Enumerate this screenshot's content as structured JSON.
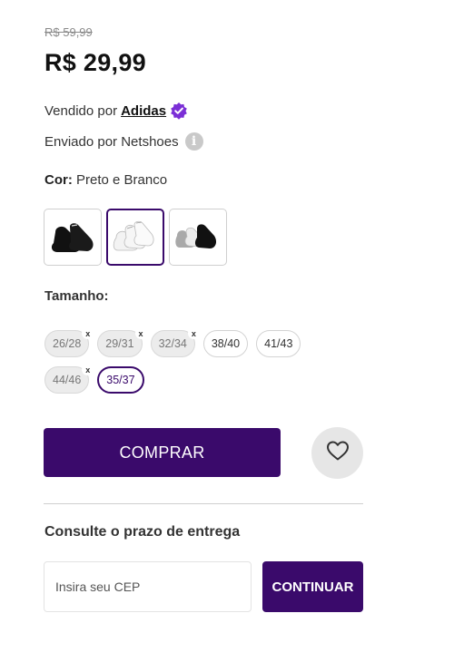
{
  "price": {
    "old": "R$ 59,99",
    "current": "R$ 29,99"
  },
  "seller": {
    "prefix": "Vendido por",
    "name": "Adidas",
    "verified_icon": "verified-badge-icon"
  },
  "shipping": {
    "text": "Enviado por Netshoes",
    "info_icon": "info-icon"
  },
  "color": {
    "label": "Cor:",
    "value": "Preto e Branco",
    "swatches": [
      {
        "name": "black-socks",
        "selected": false
      },
      {
        "name": "white-socks",
        "selected": true
      },
      {
        "name": "gray-black-socks",
        "selected": false
      }
    ]
  },
  "size": {
    "label": "Tamanho:",
    "options": [
      {
        "label": "26/28",
        "unavailable": true,
        "selected": false
      },
      {
        "label": "29/31",
        "unavailable": true,
        "selected": false
      },
      {
        "label": "32/34",
        "unavailable": true,
        "selected": false
      },
      {
        "label": "38/40",
        "unavailable": false,
        "selected": false
      },
      {
        "label": "41/43",
        "unavailable": false,
        "selected": false
      },
      {
        "label": "44/46",
        "unavailable": true,
        "selected": false
      },
      {
        "label": "35/37",
        "unavailable": false,
        "selected": true
      }
    ],
    "unavailable_mark": "x"
  },
  "actions": {
    "buy_label": "COMPRAR",
    "favorite_icon": "heart-icon"
  },
  "delivery": {
    "title": "Consulte o prazo de entrega",
    "cep_placeholder": "Insira seu CEP",
    "continue_label": "CONTINUAR"
  },
  "colors": {
    "brand": "#3a0a6b",
    "verified": "#7b2fd6"
  }
}
